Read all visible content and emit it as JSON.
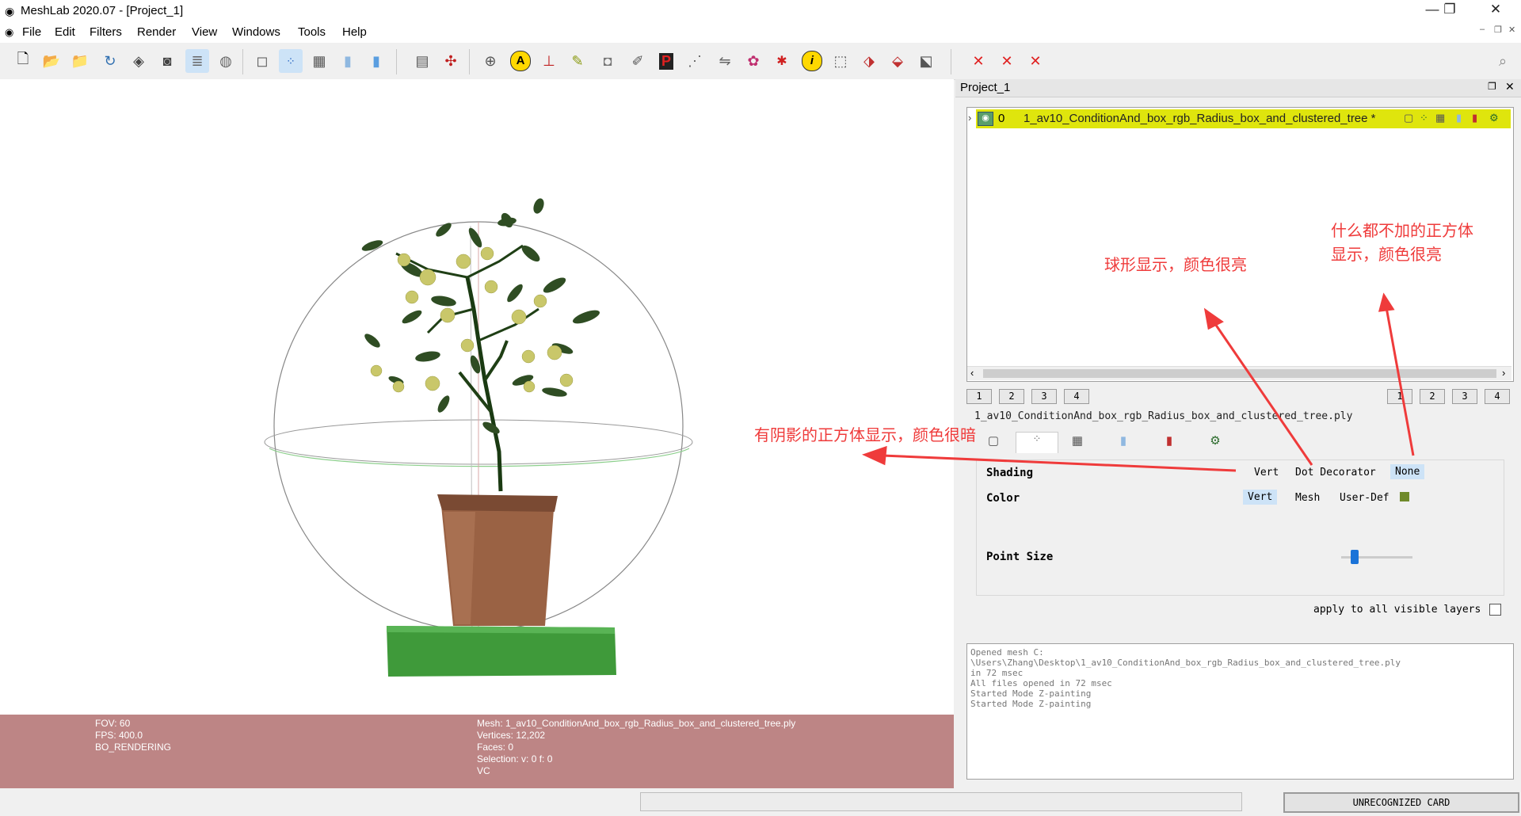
{
  "window": {
    "title": "MeshLab 2020.07 - [Project_1]",
    "controls": [
      "—",
      "❐",
      "✕"
    ],
    "mdi_controls": [
      "–",
      "❐",
      "✕"
    ]
  },
  "menu": [
    "File",
    "Edit",
    "Filters",
    "Render",
    "View",
    "Windows",
    "Tools",
    "Help"
  ],
  "project": {
    "title": "Project_1",
    "layer_index": "0",
    "layer_name": "1_av10_ConditionAnd_box_rgb_Radius_box_and_clustered_tree *",
    "view_buttons": [
      "1",
      "2",
      "3",
      "4"
    ],
    "mesh_file": "1_av10_ConditionAnd_box_rgb_Radius_box_and_clustered_tree.ply"
  },
  "render_panel": {
    "shading_label": "Shading",
    "shading_options": [
      "Vert",
      "Dot Decorator",
      "None"
    ],
    "shading_selected": "None",
    "color_label": "Color",
    "color_options": [
      "Vert",
      "Mesh",
      "User-Def"
    ],
    "color_selected": "Vert",
    "user_def_color": "#6f8a2a",
    "point_size_label": "Point Size",
    "point_size_value": 0.15,
    "apply_all_label": "apply to all visible layers"
  },
  "log": [
    "Opened mesh C:",
    "\\Users\\Zhang\\Desktop\\1_av10_ConditionAnd_box_rgb_Radius_box_and_clustered_tree.ply",
    "in 72 msec",
    "All files opened in 72 msec",
    "Started Mode Z-painting",
    "Started Mode Z-painting"
  ],
  "info_left": [
    "FOV: 60",
    "FPS:   400.0",
    "BO_RENDERING"
  ],
  "info_right": [
    "Mesh: 1_av10_ConditionAnd_box_rgb_Radius_box_and_clustered_tree.ply",
    "Vertices: 12,202",
    "Faces: 0",
    "Selection: v: 0 f: 0",
    "VC"
  ],
  "status": {
    "card": "UNRECOGNIZED CARD"
  },
  "annotations": {
    "shadow_cube": "有阴影的正方体显示，颜色很暗",
    "sphere": "球形显示，颜色很亮",
    "plain_cube_line1": "什么都不加的正方体",
    "plain_cube_line2": "显示，颜色很亮",
    "color": "#ef3b3b"
  }
}
